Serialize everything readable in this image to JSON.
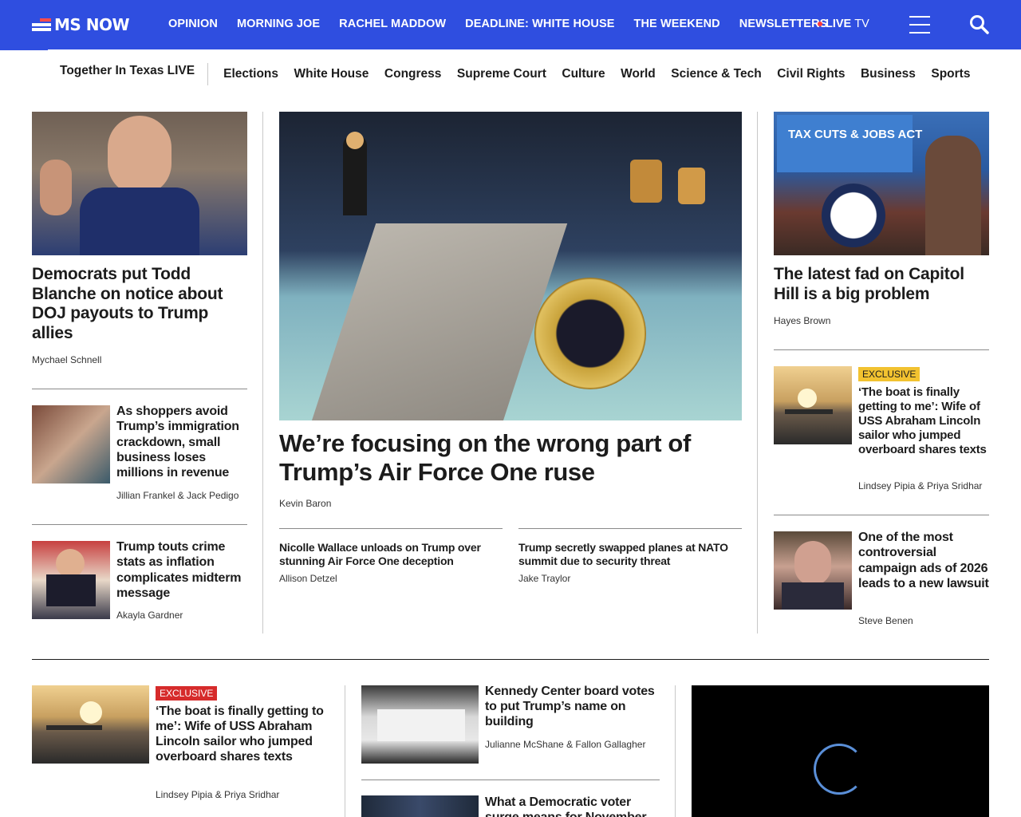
{
  "header": {
    "logo_text": "MS NOW",
    "nav": [
      "OPINION",
      "MORNING JOE",
      "RACHEL MADDOW",
      "DEADLINE: WHITE HOUSE",
      "THE WEEKEND",
      "NEWSLETTERS"
    ],
    "live_bold": "LIVE",
    "live_rest": "TV",
    "brand_color": "#2f4ee0"
  },
  "subnav": {
    "featured": "Together In Texas LIVE",
    "items": [
      "Elections",
      "White House",
      "Congress",
      "Supreme Court",
      "Culture",
      "World",
      "Science & Tech",
      "Civil Rights",
      "Business",
      "Sports"
    ]
  },
  "left_col": {
    "lead": {
      "headline": "Democrats put Todd Blanche on notice about DOJ payouts to Trump allies",
      "byline": "Mychael Schnell"
    },
    "stories": [
      {
        "headline": "As shoppers avoid Trump’s immigration crackdown, small business loses millions in revenue",
        "byline": "Jillian Frankel & Jack Pedigo"
      },
      {
        "headline": "Trump touts crime stats as inflation complicates midterm message",
        "byline": "Akayla Gardner"
      }
    ]
  },
  "center_col": {
    "lead": {
      "headline": "We’re focusing on the wrong part of Trump’s Air Force One ruse",
      "byline": "Kevin Baron"
    },
    "related": [
      {
        "headline": "Nicolle Wallace unloads on Trump over stunning Air Force One deception",
        "byline": "Allison Detzel"
      },
      {
        "headline": "Trump secretly swapped planes at NATO summit due to security threat",
        "byline": "Jake Traylor"
      }
    ]
  },
  "right_col": {
    "lead": {
      "headline": "The latest fad on Capitol Hill is a big problem",
      "byline": "Hayes Brown"
    },
    "stories": [
      {
        "badge": "EXCLUSIVE",
        "headline": "‘The boat is finally getting to me’: Wife of USS Abraham Lincoln sailor who jumped overboard shares texts",
        "byline": "Lindsey Pipia & Priya Sridhar"
      },
      {
        "headline": "One of the most controversial campaign ads of 2026 leads to a new lawsuit",
        "byline": "Steve Benen"
      }
    ]
  },
  "image_text": {
    "tax_sign": "TAX CUTS & JOBS ACT"
  },
  "bottom": {
    "story_a": {
      "badge": "EXCLUSIVE",
      "headline": "‘The boat is finally getting to me’: Wife of USS Abraham Lincoln sailor who jumped overboard shares texts",
      "byline": "Lindsey Pipia & Priya Sridhar"
    },
    "story_b": {
      "headline": "Kennedy Center board votes to put Trump’s name on building",
      "byline": "Julianne McShane & Fallon Gallagher"
    },
    "story_c": {
      "headline": "What a Democratic voter surge means for November"
    }
  },
  "colors": {
    "exclusive_gold": "#f2c230",
    "exclusive_red": "#d62b2b"
  }
}
